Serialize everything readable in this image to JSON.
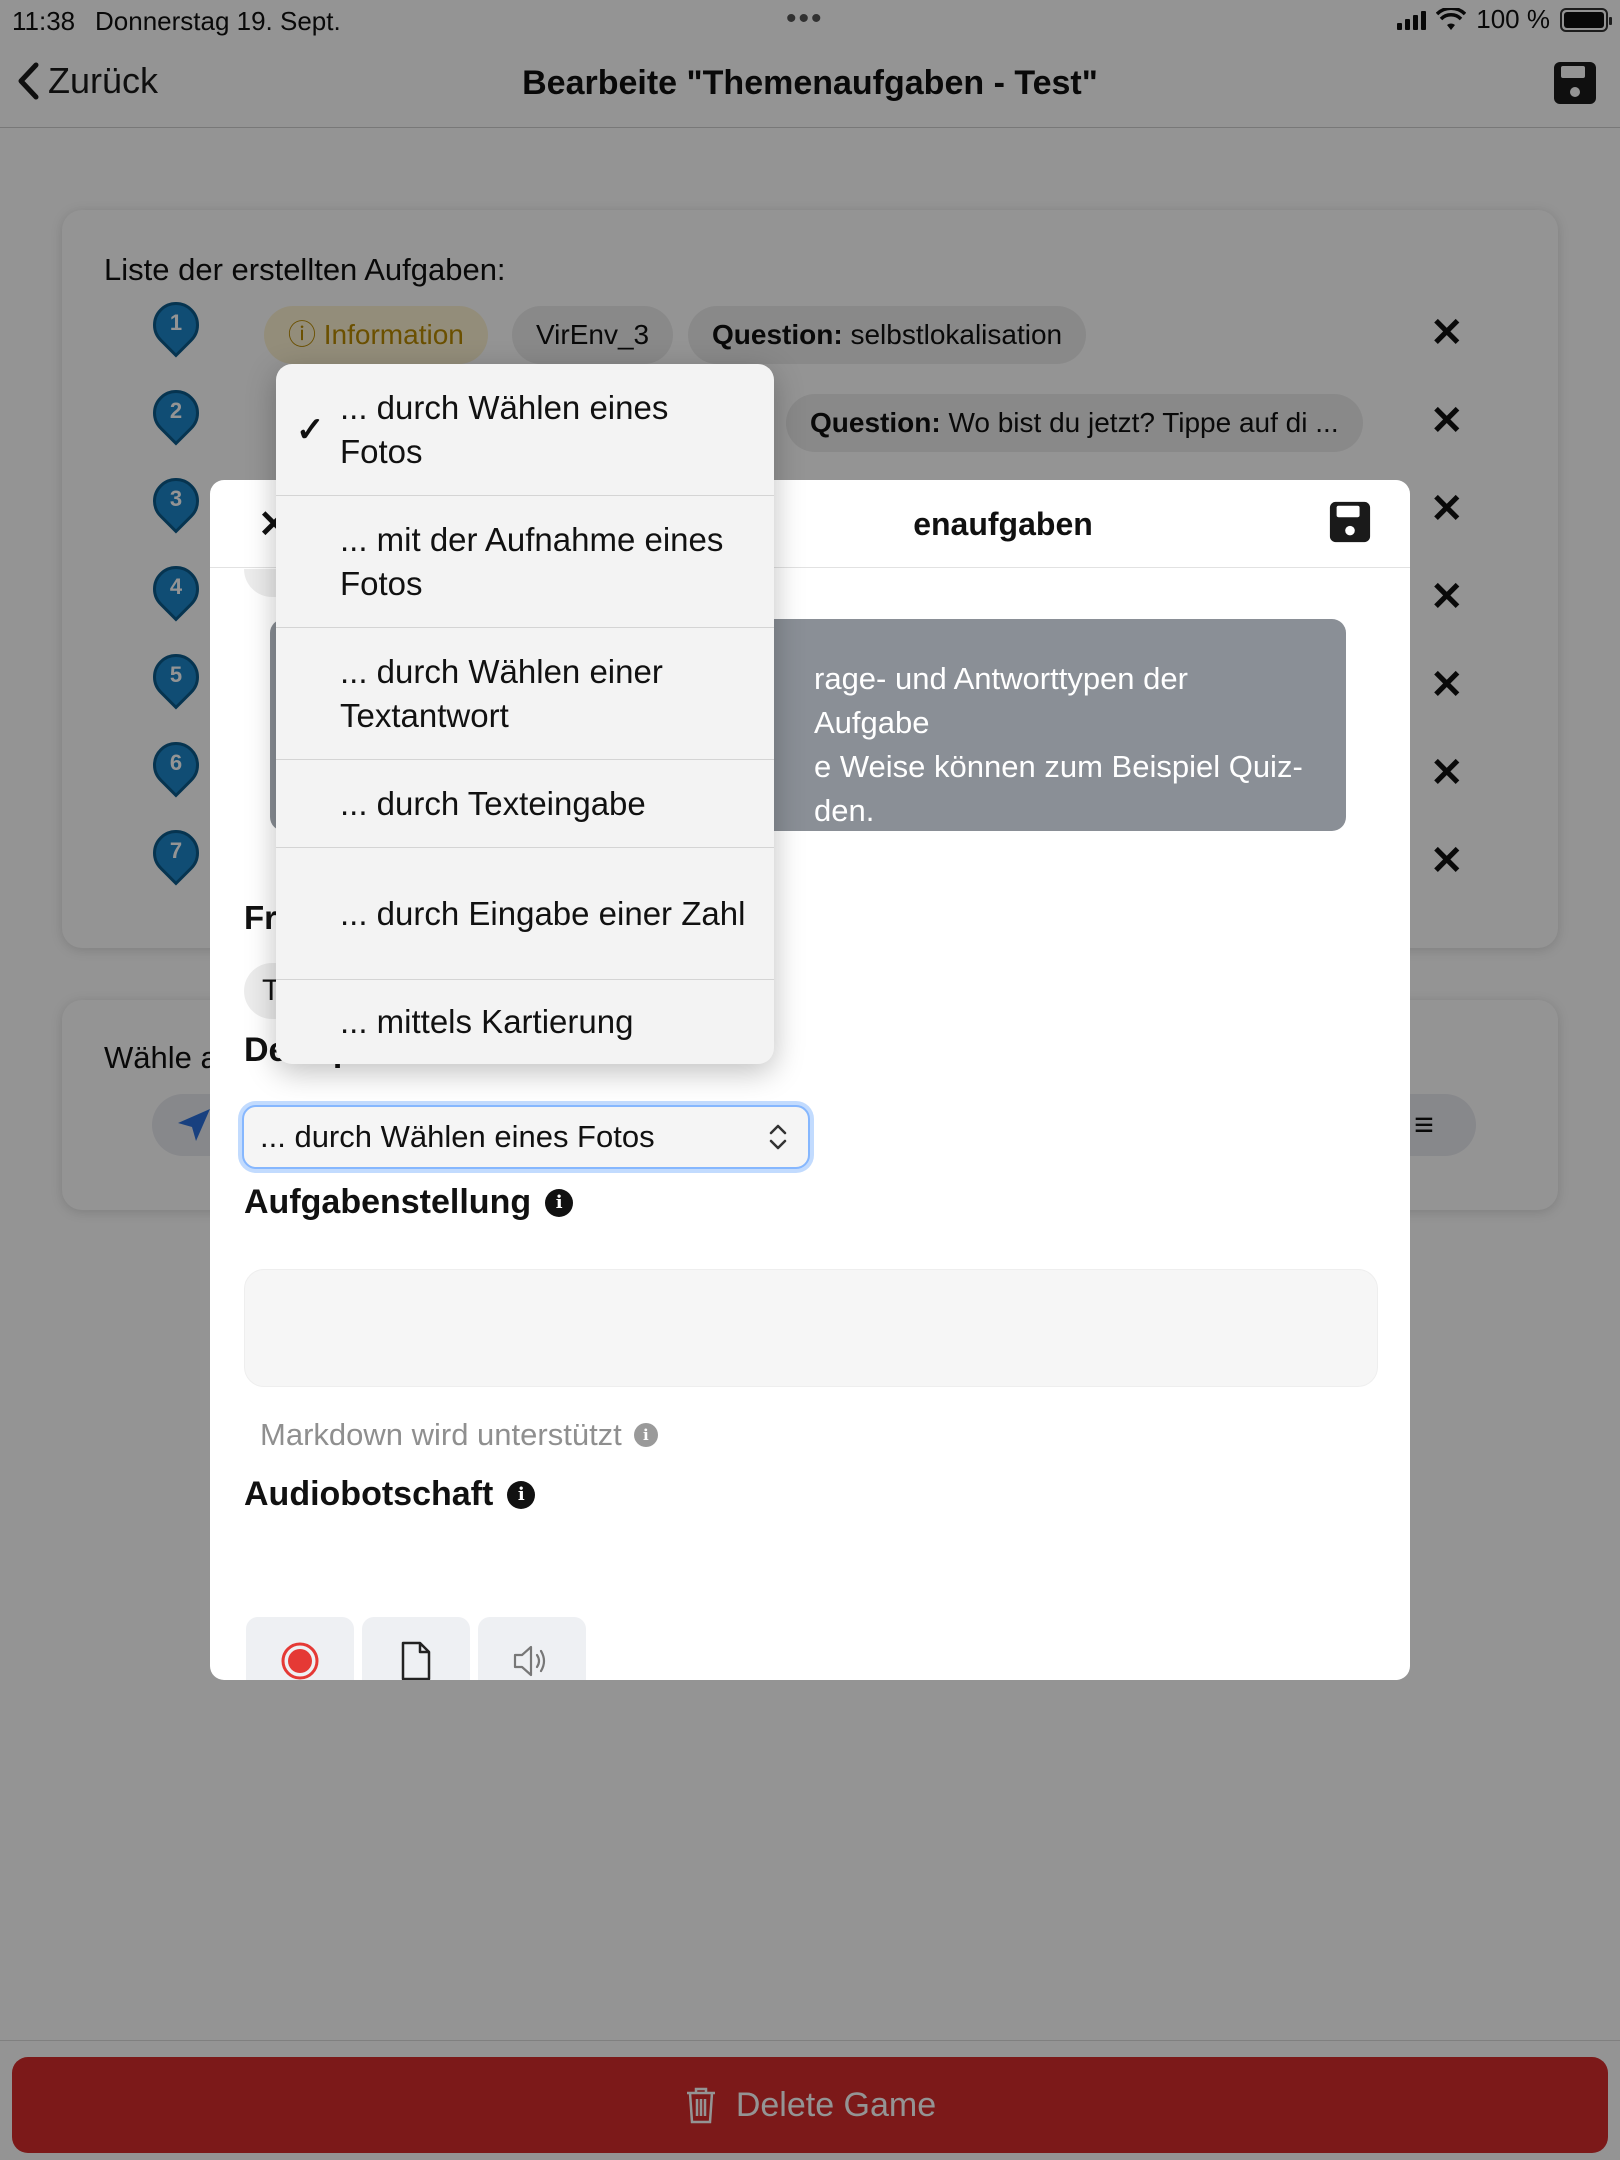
{
  "status": {
    "time": "11:38",
    "date": "Donnerstag 19. Sept.",
    "battery": "100 %"
  },
  "nav": {
    "back_label": "Zurück",
    "title": "Bearbeite \"Themenaufgaben - Test\""
  },
  "task_list": {
    "title": "Liste der erstellten Aufgaben:",
    "markers": [
      "1",
      "2",
      "3",
      "4",
      "5",
      "6",
      "7"
    ],
    "row1": {
      "info_chip": "Information",
      "env_chip": "VirEnv_3",
      "question_prefix": "Question:",
      "question_text": "selbstlokalisation"
    },
    "row2": {
      "question_prefix": "Question:",
      "question_text": "Wo bist du jetzt? Tippe auf di ..."
    }
  },
  "second_card": {
    "label_partial": "Wähle a"
  },
  "delete_button": "Delete Game",
  "modal": {
    "title_partial": "enaufgaben",
    "tooltip_lines": [
      "rage- und Antworttypen der Aufgabe",
      "e Weise können zum Beispiel Quiz-",
      "den."
    ],
    "frage_label_partial": "Fr",
    "chip_partial": "T",
    "answer_label": "Der Spieler antwortet...",
    "select_value": "... durch Wählen eines Fotos",
    "aufgabe_label": "Aufgabenstellung",
    "markdown_hint": "Markdown wird unterstützt",
    "audio_label": "Audiobotschaft"
  },
  "dropdown": {
    "selected_index": 0,
    "options": [
      "... durch Wählen eines Fotos",
      "... mit der Aufnahme eines Fotos",
      "... durch Wählen einer Textantwort",
      "... durch Texteingabe",
      "... durch Eingabe einer Zahl",
      "... mittels Kartierung"
    ]
  },
  "colors": {
    "marker": "#1d86c8",
    "delete": "#d62b2b",
    "record": "#e53935",
    "focus_ring": "#86b7fe"
  }
}
